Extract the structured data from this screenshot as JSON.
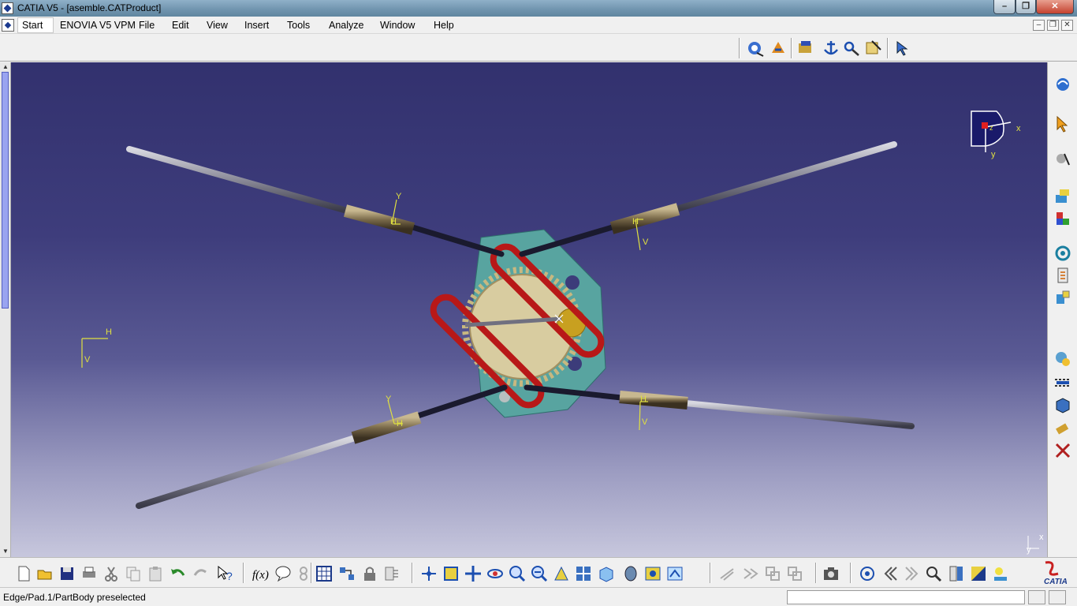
{
  "window": {
    "title": "CATIA V5 - [asemble.CATProduct]",
    "minimize": "–",
    "restore": "❐",
    "close": "✕"
  },
  "menubar": {
    "items": [
      "Start",
      "ENOVIA V5 VPM",
      "File",
      "Edit",
      "View",
      "Insert",
      "Tools",
      "Analyze",
      "Window",
      "Help"
    ]
  },
  "viewport": {
    "compass_labels": {
      "x": "x",
      "y": "y",
      "z": "z"
    },
    "corner_axis": {
      "x": "x",
      "y": "y"
    },
    "left_axis": {
      "h": "H",
      "v": "V"
    },
    "rods": [
      {
        "label_a": "Y",
        "label_b": "H"
      },
      {
        "label_a": "H",
        "label_b": "V"
      },
      {
        "label_a": "Y",
        "label_b": "H"
      },
      {
        "label_a": "H",
        "label_b": "V"
      }
    ]
  },
  "icons": {
    "top": [
      "fly-mode-icon",
      "turn-head-icon",
      "catalog-icon",
      "anchor-icon",
      "constraint-icon",
      "manipulation-icon",
      "snap-icon"
    ],
    "right": [
      "product-structure-icon",
      "select-icon",
      "move-icon",
      "existing-component-icon",
      "new-part-icon",
      "replace-icon",
      "graph-tree-icon",
      "assembly-constraint-icon",
      "explode-icon",
      "clash-icon",
      "catalog-browser-icon",
      "sectioning-icon",
      "measure-icon"
    ],
    "bottom": [
      "new-icon",
      "open-icon",
      "save-icon",
      "print-icon",
      "cut-icon",
      "copy-icon",
      "paste-icon",
      "undo-icon",
      "redo-icon",
      "whats-this-icon",
      "formula-icon",
      "knowledge-icon",
      "macro-icon",
      "table-icon",
      "scan-icon",
      "lock-icon",
      "publish-icon",
      "compass-icon",
      "fit-all-icon",
      "pan-icon",
      "rotate-icon",
      "zoom-in-icon",
      "zoom-out-icon",
      "normal-view-icon",
      "multi-view-icon",
      "iso-view-icon",
      "shading-icon",
      "hide-show-icon",
      "swap-space-icon",
      "parallel-icon",
      "capture-icon",
      "target-icon",
      "first-icon",
      "next-icon",
      "search-icon",
      "tree-icon",
      "image-icon",
      "light-icon"
    ]
  },
  "status": {
    "text": "Edge/Pad.1/PartBody preselected",
    "power_input_placeholder": ""
  },
  "brand": "CATIA"
}
